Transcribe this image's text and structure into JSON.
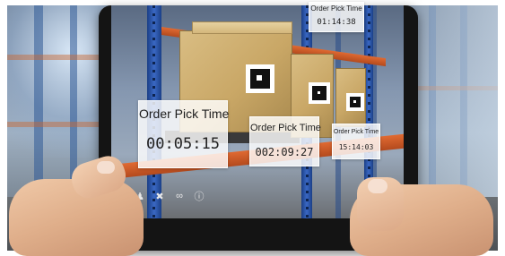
{
  "overlay_labels": [
    {
      "title": "Order Pick Time",
      "value": "00:05:15"
    },
    {
      "title": "Order Pick Time",
      "value": "002:09:27"
    },
    {
      "title": "Order Pick Time",
      "value": "15:14:03"
    },
    {
      "title": "Order Pick Time",
      "value": "01:14:38"
    }
  ],
  "toolbar": {
    "icons": [
      "menu-icon",
      "people-icon",
      "tools-icon",
      "link-icon",
      "info-icon"
    ]
  },
  "colors": {
    "rack_blue": "#2a58b0",
    "beam_orange": "#d45d28",
    "box_cardboard": "#c9a766",
    "label_background": "#ffffff"
  }
}
